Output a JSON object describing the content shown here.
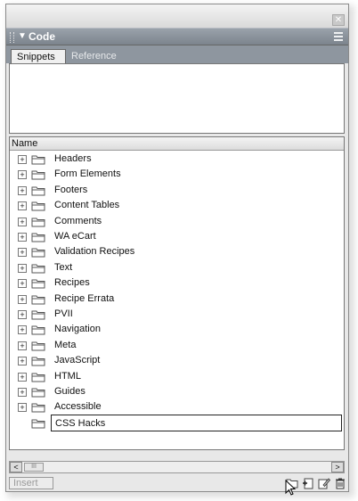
{
  "window": {
    "close_glyph": "✕"
  },
  "panel": {
    "title": "Code",
    "collapse_glyph": "▼"
  },
  "tabs": [
    {
      "label": "Snippets",
      "active": true
    },
    {
      "label": "Reference",
      "active": false
    }
  ],
  "list": {
    "column_header": "Name",
    "items": [
      {
        "label": "Headers",
        "expandable": true
      },
      {
        "label": "Form Elements",
        "expandable": true
      },
      {
        "label": "Footers",
        "expandable": true
      },
      {
        "label": "Content Tables",
        "expandable": true
      },
      {
        "label": "Comments",
        "expandable": true
      },
      {
        "label": "WA eCart",
        "expandable": true
      },
      {
        "label": "Validation Recipes",
        "expandable": true
      },
      {
        "label": "Text",
        "expandable": true
      },
      {
        "label": "Recipes",
        "expandable": true
      },
      {
        "label": "Recipe Errata",
        "expandable": true
      },
      {
        "label": "PVII",
        "expandable": true
      },
      {
        "label": "Navigation",
        "expandable": true
      },
      {
        "label": "Meta",
        "expandable": true
      },
      {
        "label": "JavaScript",
        "expandable": true
      },
      {
        "label": "HTML",
        "expandable": true
      },
      {
        "label": "Guides",
        "expandable": true
      },
      {
        "label": "Accessible",
        "expandable": true
      }
    ],
    "new_item": {
      "value": "CSS Hacks"
    }
  },
  "scrollbar": {
    "left_glyph": "<",
    "right_glyph": ">",
    "thumb_glyph": "III"
  },
  "footer": {
    "insert_label": "Insert",
    "tools": [
      "new-folder-icon",
      "new-snippet-icon",
      "edit-snippet-icon",
      "delete-icon"
    ]
  },
  "colors": {
    "header": "#8c949d",
    "tab_active": "#f0f0f0"
  }
}
